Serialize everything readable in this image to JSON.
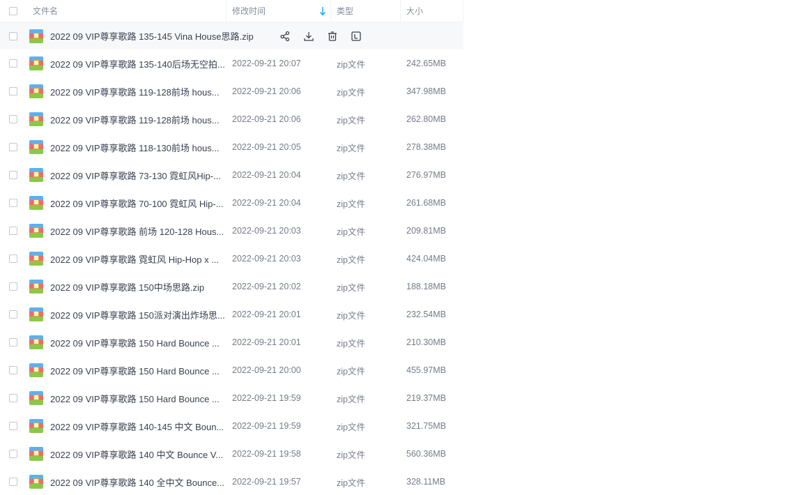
{
  "header": {
    "name": "文件名",
    "modified": "修改时间",
    "type": "类型",
    "size": "大小"
  },
  "hover_row": {
    "name": "2022 09 VIP尊享歌路  135-145 Vina House思路.zip",
    "actions": [
      "share-icon",
      "download-icon",
      "delete-icon",
      "more-icon"
    ]
  },
  "rows": [
    {
      "name": "2022 09 VIP尊享歌路  135-140后场无空拍...",
      "modified": "2022-09-21 20:07",
      "type": "zip文件",
      "size": "242.65MB"
    },
    {
      "name": "2022 09 VIP尊享歌路  119-128前场 hous...",
      "modified": "2022-09-21 20:06",
      "type": "zip文件",
      "size": "347.98MB"
    },
    {
      "name": "2022 09 VIP尊享歌路  119-128前场 hous...",
      "modified": "2022-09-21 20:06",
      "type": "zip文件",
      "size": "262.80MB"
    },
    {
      "name": "2022 09 VIP尊享歌路  118-130前场 hous...",
      "modified": "2022-09-21 20:05",
      "type": "zip文件",
      "size": "278.38MB"
    },
    {
      "name": "2022 09 VIP尊享歌路  73-130 霓虹风Hip-...",
      "modified": "2022-09-21 20:04",
      "type": "zip文件",
      "size": "276.97MB"
    },
    {
      "name": "2022 09 VIP尊享歌路 70-100 霓虹风 Hip-...",
      "modified": "2022-09-21 20:04",
      "type": "zip文件",
      "size": "261.68MB"
    },
    {
      "name": "2022 09 VIP尊享歌路  前场 120-128 Hous...",
      "modified": "2022-09-21 20:03",
      "type": "zip文件",
      "size": "209.81MB"
    },
    {
      "name": "2022 09 VIP尊享歌路  霓虹风 Hip-Hop x ...",
      "modified": "2022-09-21 20:03",
      "type": "zip文件",
      "size": "424.04MB"
    },
    {
      "name": "2022 09 VIP尊享歌路  150中场思路.zip",
      "modified": "2022-09-21 20:02",
      "type": "zip文件",
      "size": "188.18MB"
    },
    {
      "name": "2022 09 VIP尊享歌路  150派对演出炸场思...",
      "modified": "2022-09-21 20:01",
      "type": "zip文件",
      "size": "232.54MB"
    },
    {
      "name": "2022 09 VIP尊享歌路  150 Hard Bounce ...",
      "modified": "2022-09-21 20:01",
      "type": "zip文件",
      "size": "210.30MB"
    },
    {
      "name": "2022 09 VIP尊享歌路  150 Hard Bounce ...",
      "modified": "2022-09-21 20:00",
      "type": "zip文件",
      "size": "455.97MB"
    },
    {
      "name": "2022 09 VIP尊享歌路  150 Hard Bounce ...",
      "modified": "2022-09-21 19:59",
      "type": "zip文件",
      "size": "219.37MB"
    },
    {
      "name": "2022 09 VIP尊享歌路  140-145 中文 Boun...",
      "modified": "2022-09-21 19:59",
      "type": "zip文件",
      "size": "321.75MB"
    },
    {
      "name": "2022 09 VIP尊享歌路  140 中文 Bounce V...",
      "modified": "2022-09-21 19:58",
      "type": "zip文件",
      "size": "560.36MB"
    },
    {
      "name": "2022 09 VIP尊享歌路  140 全中文 Bounce...",
      "modified": "2022-09-21 19:57",
      "type": "zip文件",
      "size": "328.11MB"
    }
  ],
  "colors": {
    "sort_arrow": "#06a7ff",
    "header_text": "#878c9c",
    "hover_bg": "#f7f8fa"
  }
}
